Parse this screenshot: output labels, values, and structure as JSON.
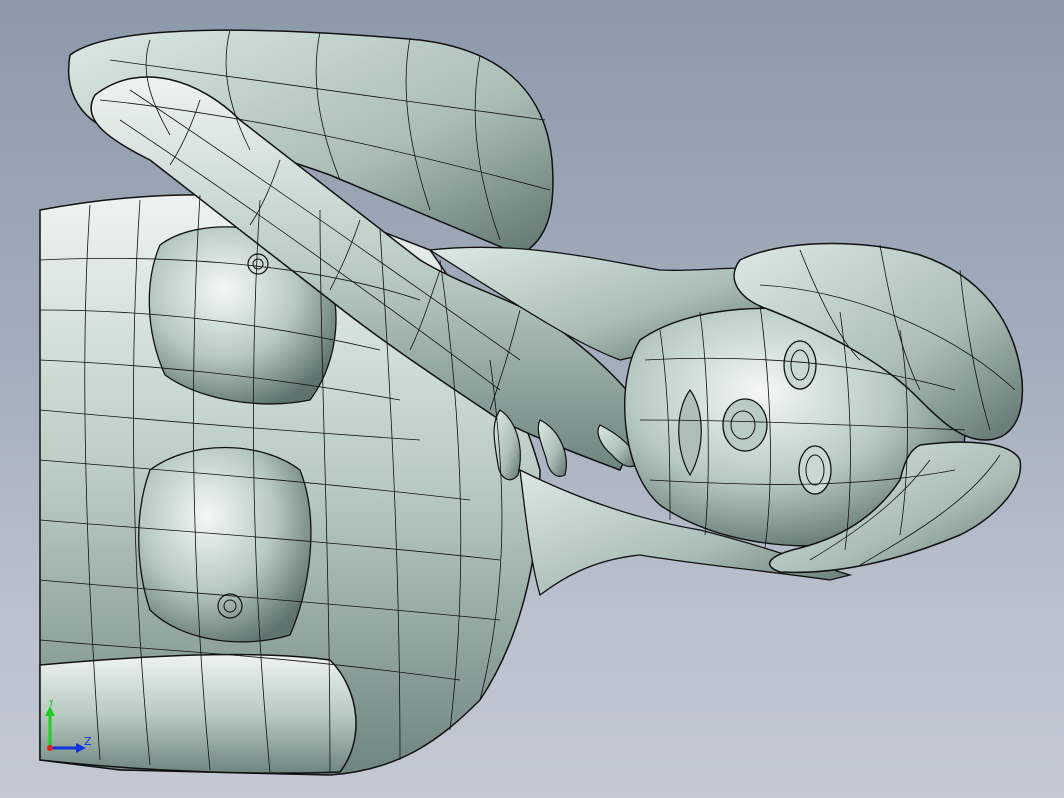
{
  "viewport": {
    "background_top": "#8d99ab",
    "background_bottom": "#c4c9d3"
  },
  "model": {
    "surface_color": "#b9ccc4",
    "edge_color": "#111111"
  },
  "triad": {
    "y_label": "Y",
    "z_label": "Z",
    "y_color": "#22cc22",
    "z_color": "#1133dd",
    "x_color": "#dd2222"
  }
}
